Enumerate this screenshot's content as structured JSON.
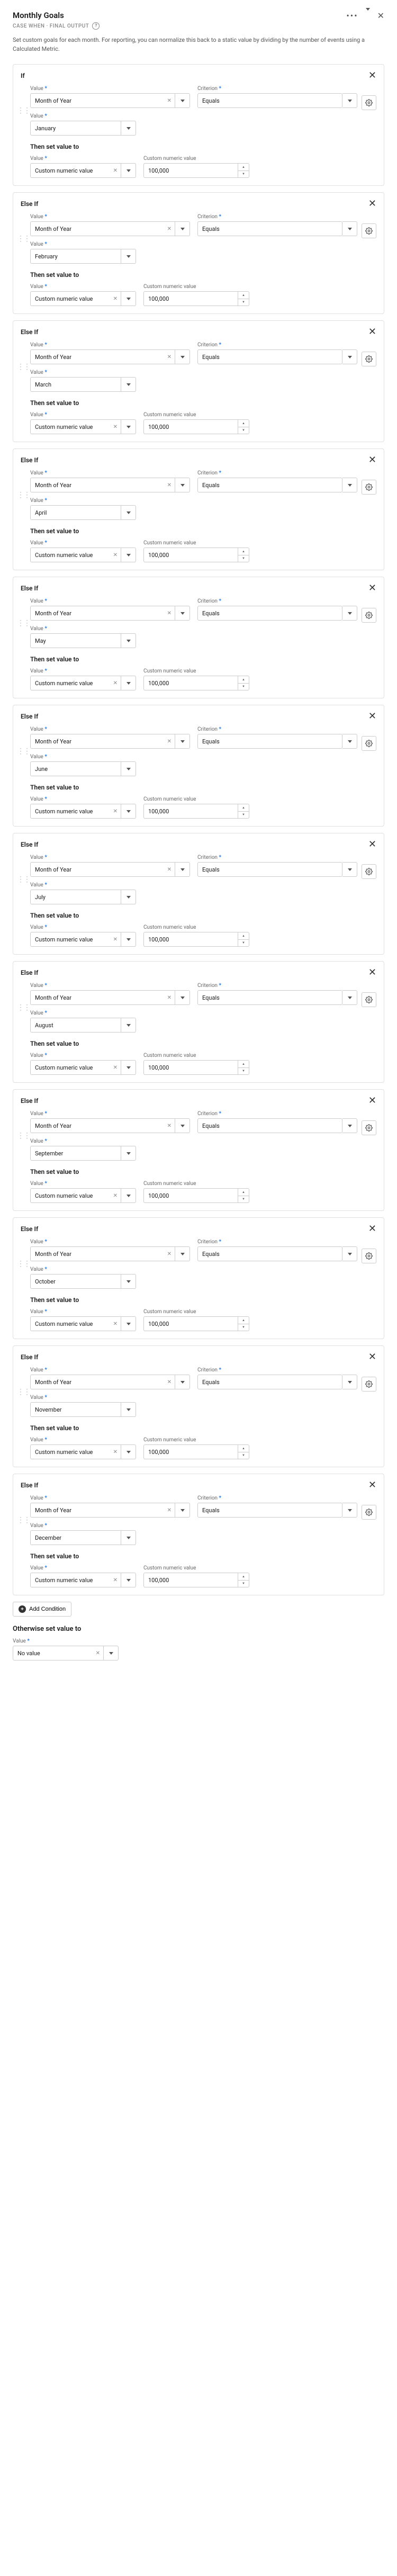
{
  "header": {
    "title": "Monthly Goals",
    "subtitle": "CASE WHEN · FINAL OUTPUT",
    "description": "Set custom goals for each month. For reporting, you can normalize this back to a static value by dividing by the number of events using a Calculated Metric."
  },
  "labels": {
    "value": "Value",
    "criterion": "Criterion",
    "custom_numeric_value": "Custom numeric value",
    "set_value": "Then set value to",
    "add_condition": "Add Condition",
    "otherwise": "Otherwise set value to",
    "value_type": "Custom numeric value",
    "no_value": "No value"
  },
  "common": {
    "value_field": "Month of Year",
    "criterion": "Equals"
  },
  "cases": [
    {
      "header": "If",
      "month": "January",
      "set_value": "100,000"
    },
    {
      "header": "Else If",
      "month": "February",
      "set_value": "100,000"
    },
    {
      "header": "Else If",
      "month": "March",
      "set_value": "100,000"
    },
    {
      "header": "Else If",
      "month": "April",
      "set_value": "100,000"
    },
    {
      "header": "Else If",
      "month": "May",
      "set_value": "100,000"
    },
    {
      "header": "Else If",
      "month": "June",
      "set_value": "100,000"
    },
    {
      "header": "Else If",
      "month": "July",
      "set_value": "100,000"
    },
    {
      "header": "Else If",
      "month": "August",
      "set_value": "100,000"
    },
    {
      "header": "Else If",
      "month": "September",
      "set_value": "100,000"
    },
    {
      "header": "Else If",
      "month": "October",
      "set_value": "100,000"
    },
    {
      "header": "Else If",
      "month": "November",
      "set_value": "100,000"
    },
    {
      "header": "Else If",
      "month": "December",
      "set_value": "100,000"
    }
  ]
}
